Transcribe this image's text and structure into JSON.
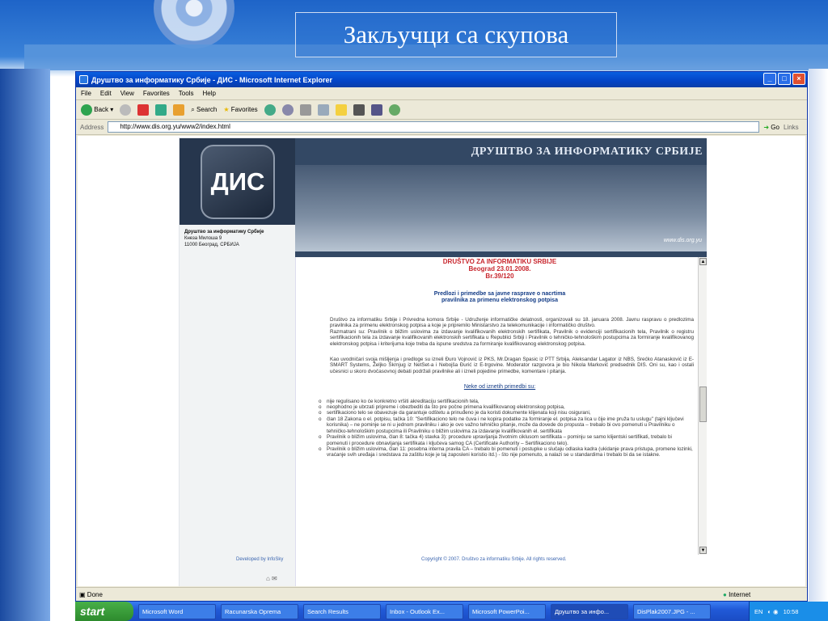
{
  "slide": {
    "title": "Закључци са скупова"
  },
  "window": {
    "title": "Друштво за информатику Србије - ДИС - Microsoft Internet Explorer",
    "controls": [
      "_",
      "□",
      "×"
    ]
  },
  "menubar": [
    "File",
    "Edit",
    "View",
    "Favorites",
    "Tools",
    "Help"
  ],
  "toolbar": {
    "back": "Back",
    "search": "Search",
    "favorites": "Favorites"
  },
  "address": {
    "label": "Address",
    "url": "http://www.dis.org.yu/www2/index.html",
    "go": "Go",
    "links": "Links"
  },
  "site": {
    "header_title": "ДРУШТВО ЗА ИНФОРМАТИКУ СРБИЈЕ",
    "logo_text": "ДИС",
    "header_url": "www.dis.org.yu",
    "org_name": "Друштво за информатику Србије",
    "org_street": "Кнеза Милоша 9",
    "org_city": "11000 Београд, СРБИЈА",
    "developed_by": "Developed by InfoSky",
    "copyright": "Copyright © 2007. Društvo za informatiku Srbije. All rights reserved."
  },
  "article": {
    "org": "DRUŠTVO ZA INFORMATIKU SRBIJE",
    "place_date": "Beograd 23.01.2008.",
    "number": "Br.39/120",
    "heading1": "Predlozi i primedbe sa javne rasprave o nacrtima",
    "heading2": "pravilnika za primenu elektronskog potpisa",
    "para1": "Društvo za informatiku Srbije i Privredna komora Srbije - Udruženje informatičke delatnosti, organizovali su 18. januara 2008. Javnu raspravu o predlozima pravilnika za primenu elektronskog potpisa a koje je pripremilo Ministarstvo za telekomunikacije i informatičko društvo.",
    "para1b": "Razmatrani su: Pravilnik o bližim uslovima za izdavanje kvalifikovanih elektronskih sertifikata, Pravilnik o evidenciji sertifikacionih tela, Pravilnik o registru sertifikacionih tela za izdavanje kvalifikovanih elektronskih sertifikata u Republici Srbiji i Pravilnik o tehničko-tehnološkim postupcima za formiranje kvalifikovanog elektronskog potpisa i kriterijuma koje treba da ispune sredstva za formiranje kvalifikovanog elektronskog potpisa.",
    "para2": "Kao uvodničari svoja mišljenja i predloge su izneli Đuro Vojnović iz PKS, Mr.Dragan Spasic iz PTT Srbija, Aleksandar Lagator iz NBS, Srećko Atanasković iz E-SMART Systems, Željko Škrnjug iz NetSet-a i Nebojša Đurić iz E-trgovine. Moderator razgovora je bio Nikola Marković predsednik DIS. Oni su, kao i ostali učesnici u skoro dvočasovnoj debati podržali pravilnike ali i izneli pojedine primedbe, komentare i pitanja.",
    "subheading": "Neke od iznetih primedbi su:",
    "bullets": [
      "nije regulisano ko će konkretno vršiti akreditaciju sertifikacionih tela,",
      "neophodno je ubrzati pripreme i obezbediti da što pre počne primena kvalifikovanog elektronskog potpisa,",
      "sertifikaciono telo se obavezuje da garantuje odštetu a prinuđeno je da koristi dokumente klijenata koji nisu osigurani,",
      "član 18 Zakona o el. potpisu, tačka 10: \"Sertifikaciono telo ne čuva i ne kopira podatke za formiranje el. potpisa za lica u čije ime pruža tu uslugu\" (tajni ključevi korisnika) – ne pominje se ni u jednom pravilniku i ako je ovo važno tehničko pitanje, može da dovede do propusta – trebalo bi ovo pomenuti u Pravilniku o tehničko-tehnološkim postupcima ili Pravilniku o bližim uslovima za izdavanje kvalifikovanih el. sertifikata",
      "Pravilnik o bližim uslovima, član 8: tačka 4) stavka 3): procedure upravljanja životnim ciklusom sertifikata – pominju se samo klijentski sertifikati, trebalo bi pomenuti i procedure obnavljanja sertifikata i ključeva samog CA (Certificate Authority – Sertifikaciono telo).",
      "Pravilnik o bližim uslovima, član 11: posebna interna pravila CA – trebalo bi pomenuti i postupke u slučaju odlaska kadra (ukidanje prava pristupa, promene lozinki, vraćanje svih uređaja i sredstava za zaštitu koje je taj zaposleni koristio itd.) - što nije pomenuto, a nalazi se u standardima i trebalo bi da se istakne."
    ]
  },
  "status": {
    "left": "Done",
    "zone": "Internet"
  },
  "taskbar": {
    "start": "start",
    "tasks": [
      "Microsoft Word",
      "Racunarska Oprema",
      "Search Results",
      "Inbox - Outlook Ex...",
      "Microsoft PowerPoi...",
      "Друштво за инфо...",
      "DisPlak2007.JPG - ..."
    ],
    "lang": "EN",
    "clock": "10:58"
  }
}
